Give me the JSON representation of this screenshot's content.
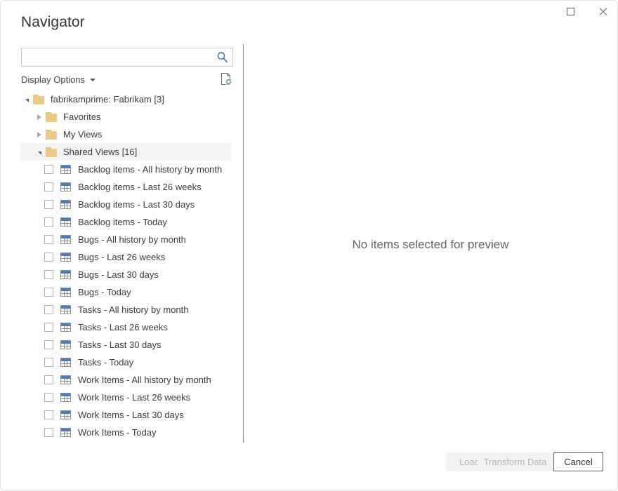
{
  "window": {
    "title": "Navigator",
    "controls": {
      "maximize": "maximize-button",
      "close": "close-button"
    }
  },
  "search": {
    "value": "",
    "placeholder": "",
    "icon": "search-icon"
  },
  "toolbar": {
    "display_options_label": "Display Options",
    "refresh_preview_icon": "document-refresh-icon"
  },
  "tree": {
    "root": {
      "label": "fabrikamprime: Fabrikam [3]",
      "expanded": true,
      "icon": "folder-icon"
    },
    "nodes": [
      {
        "label": "Favorites",
        "expanded": false,
        "icon": "folder-icon",
        "selected": false
      },
      {
        "label": "My Views",
        "expanded": false,
        "icon": "folder-icon",
        "selected": false
      },
      {
        "label": "Shared Views [16]",
        "expanded": true,
        "icon": "folder-icon",
        "selected": true
      }
    ],
    "items": [
      {
        "label": "Backlog items - All history by month",
        "checked": false,
        "icon": "table-icon"
      },
      {
        "label": "Backlog items - Last 26 weeks",
        "checked": false,
        "icon": "table-icon"
      },
      {
        "label": "Backlog items - Last 30 days",
        "checked": false,
        "icon": "table-icon"
      },
      {
        "label": "Backlog items - Today",
        "checked": false,
        "icon": "table-icon"
      },
      {
        "label": "Bugs - All history by month",
        "checked": false,
        "icon": "table-icon"
      },
      {
        "label": "Bugs - Last 26 weeks",
        "checked": false,
        "icon": "table-icon"
      },
      {
        "label": "Bugs - Last 30 days",
        "checked": false,
        "icon": "table-icon"
      },
      {
        "label": "Bugs - Today",
        "checked": false,
        "icon": "table-icon"
      },
      {
        "label": "Tasks - All history by month",
        "checked": false,
        "icon": "table-icon"
      },
      {
        "label": "Tasks - Last 26 weeks",
        "checked": false,
        "icon": "table-icon"
      },
      {
        "label": "Tasks - Last 30 days",
        "checked": false,
        "icon": "table-icon"
      },
      {
        "label": "Tasks - Today",
        "checked": false,
        "icon": "table-icon"
      },
      {
        "label": "Work Items - All history by month",
        "checked": false,
        "icon": "table-icon"
      },
      {
        "label": "Work Items - Last 26 weeks",
        "checked": false,
        "icon": "table-icon"
      },
      {
        "label": "Work Items - Last 30 days",
        "checked": false,
        "icon": "table-icon"
      },
      {
        "label": "Work Items - Today",
        "checked": false,
        "icon": "table-icon"
      }
    ]
  },
  "preview": {
    "empty_message": "No items selected for preview"
  },
  "footer": {
    "load_label": "Load",
    "load_enabled": false,
    "transform_label": "Transform Data",
    "transform_enabled": false,
    "cancel_label": "Cancel",
    "cancel_enabled": true
  },
  "colors": {
    "folder": "#eec982",
    "table_header": "#4a7ebb",
    "search_icon": "#3a6ea5",
    "refresh_arrows": "#4e9a7d",
    "selection_row": "#f3f3f3",
    "divider": "#7a7a7a",
    "text": "#333333"
  }
}
